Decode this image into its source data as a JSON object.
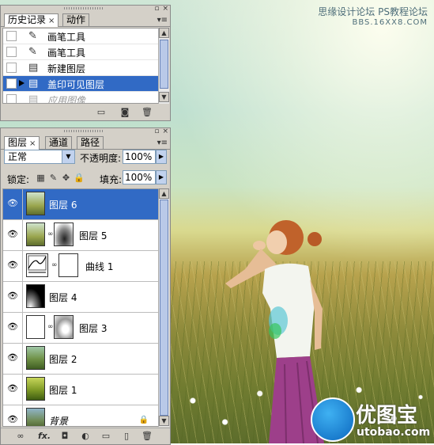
{
  "watermark": {
    "line1": "思缘设计论坛",
    "line2": "PS教程论坛",
    "line3": "BBS.16XX8.COM"
  },
  "history_panel": {
    "tabs": [
      {
        "label": "历史记录",
        "close": "×"
      },
      {
        "label": "动作"
      }
    ],
    "items": [
      {
        "label": "画笔工具",
        "icon": "brush-icon",
        "state": "normal"
      },
      {
        "label": "画笔工具",
        "icon": "brush-icon",
        "state": "normal"
      },
      {
        "label": "新建图层",
        "icon": "document-icon",
        "state": "normal"
      },
      {
        "label": "盖印可见图层",
        "icon": "document-icon",
        "state": "selected"
      },
      {
        "label": "应用图像",
        "icon": "document-icon",
        "state": "dimmed"
      }
    ]
  },
  "layers_panel": {
    "tabs": [
      {
        "label": "图层",
        "close": "×"
      },
      {
        "label": "通道"
      },
      {
        "label": "路径"
      }
    ],
    "blend_mode": "正常",
    "opacity_label": "不透明度:",
    "opacity_value": "100%",
    "lock_label": "锁定:",
    "fill_label": "填充:",
    "fill_value": "100%",
    "layers": [
      {
        "name": "图层 6",
        "selected": true
      },
      {
        "name": "图层 5",
        "has_mask": true
      },
      {
        "name": "曲线 1",
        "adjustment": true
      },
      {
        "name": "图层 4"
      },
      {
        "name": "图层 3",
        "has_mask": true
      },
      {
        "name": "图层 2"
      },
      {
        "name": "图层 1"
      },
      {
        "name": "背景",
        "background": true
      }
    ],
    "bottom_fx": "fx."
  },
  "logo": {
    "text": "优图宝",
    "url": "utobao.com"
  },
  "colors": {
    "selection": "#316ac5",
    "panel": "#d4d0c8"
  }
}
